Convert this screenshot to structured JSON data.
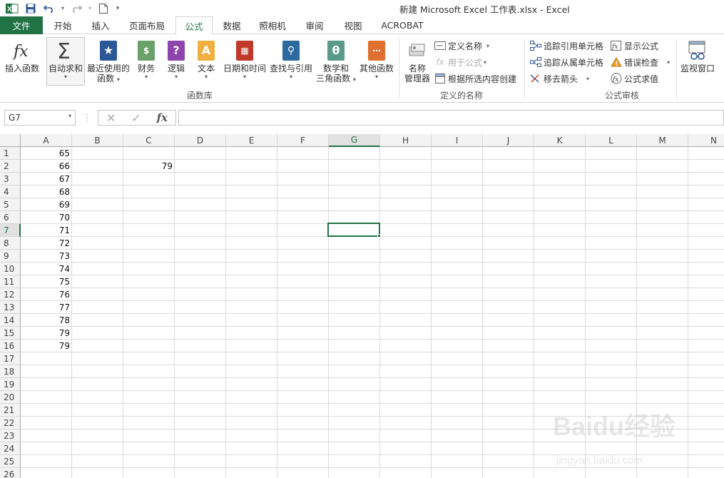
{
  "title": "新建 Microsoft Excel 工作表.xlsx - Excel",
  "tabs": [
    "文件",
    "开始",
    "插入",
    "页面布局",
    "公式",
    "数据",
    "照相机",
    "审阅",
    "视图",
    "ACROBAT"
  ],
  "active_tab": "公式",
  "ribbon": {
    "insert_function": "插入函数",
    "autosum": "自动求和",
    "recent_line1": "最近使用的",
    "recent_line2": "函数",
    "financial": "财务",
    "logical": "逻辑",
    "text": "文本",
    "datetime": "日期和时间",
    "lookup": "查找与引用",
    "math_line1": "数学和",
    "math_line2": "三角函数",
    "more": "其他函数",
    "group_library": "函数库",
    "name_manager_line1": "名称",
    "name_manager_line2": "管理器",
    "define_name": "定义名称",
    "use_in_formula": "用于公式",
    "create_from_selection": "根据所选内容创建",
    "group_defined_names": "定义的名称",
    "trace_precedents": "追踪引用单元格",
    "trace_dependents": "追踪从属单元格",
    "remove_arrows": "移去箭头",
    "show_formulas": "显示公式",
    "error_checking": "错误检查",
    "evaluate_formula": "公式求值",
    "group_auditing": "公式审核",
    "watch_window": "监视窗口"
  },
  "formula_bar": {
    "name_box": "G7",
    "fx": "fx",
    "content": ""
  },
  "columns": [
    "A",
    "B",
    "C",
    "D",
    "E",
    "F",
    "G",
    "H",
    "I",
    "J",
    "K",
    "L",
    "M",
    "N"
  ],
  "selected_column": "G",
  "rows": [
    "1",
    "2",
    "3",
    "4",
    "5",
    "6",
    "7",
    "8",
    "9",
    "10",
    "11",
    "12",
    "13",
    "14",
    "15",
    "16",
    "17",
    "18",
    "19",
    "20",
    "21",
    "22",
    "23",
    "24",
    "25",
    "26"
  ],
  "selected_row": "7",
  "column_a_values": [
    "65",
    "66",
    "67",
    "68",
    "69",
    "70",
    "71",
    "72",
    "73",
    "74",
    "75",
    "76",
    "77",
    "78",
    "79",
    "79"
  ],
  "cell_c2": "79",
  "watermark": {
    "brand": "Baidu经验",
    "url": "jingyan.baidu.com"
  }
}
